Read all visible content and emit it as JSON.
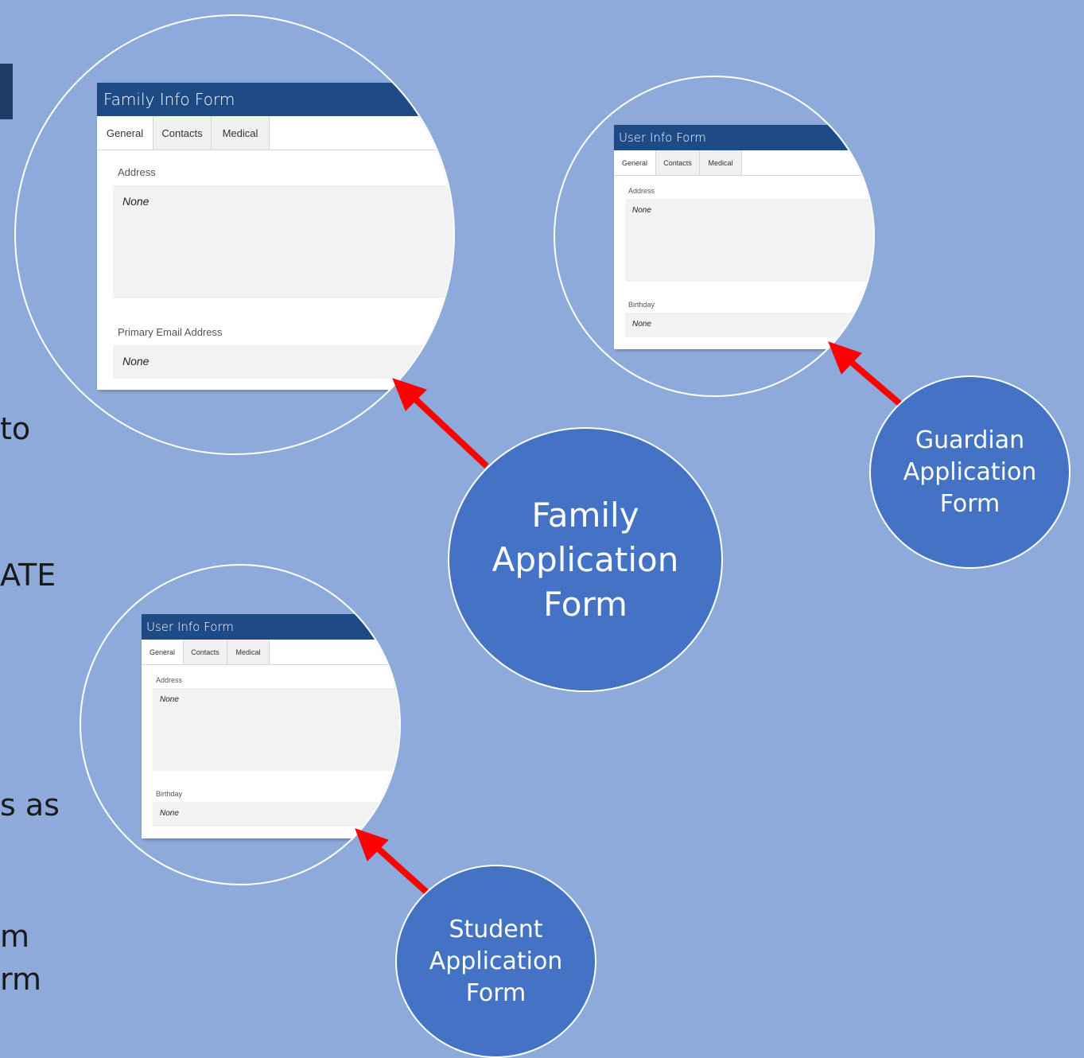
{
  "background_text": {
    "line1": "to",
    "line2": "ATE",
    "line3": "s as",
    "line4": "m",
    "line5": "rm"
  },
  "family_form": {
    "title": "Family Info Form",
    "tabs": [
      "General",
      "Contacts",
      "Medical"
    ],
    "fields": [
      {
        "label": "Address",
        "value": "None"
      },
      {
        "label": "Primary Email Address",
        "value": "None"
      }
    ]
  },
  "guardian_form": {
    "title": "User Info Form",
    "tabs": [
      "General",
      "Contacts",
      "Medical"
    ],
    "fields": [
      {
        "label": "Address",
        "value": "None"
      },
      {
        "label": "Birthday",
        "value": "None"
      }
    ]
  },
  "student_form": {
    "title": "User Info Form",
    "tabs": [
      "General",
      "Contacts",
      "Medical"
    ],
    "fields": [
      {
        "label": "Address",
        "value": "None"
      },
      {
        "label": "Birthday",
        "value": "None"
      }
    ]
  },
  "badges": {
    "family": [
      "Family",
      "Application",
      "Form"
    ],
    "guardian": [
      "Guardian",
      "Application",
      "Form"
    ],
    "student": [
      "Student",
      "Application",
      "Form"
    ]
  },
  "colors": {
    "background": "#8eaadb",
    "badge": "#4472c4",
    "form_header": "#1e4a86",
    "arrow": "#ff0000"
  }
}
